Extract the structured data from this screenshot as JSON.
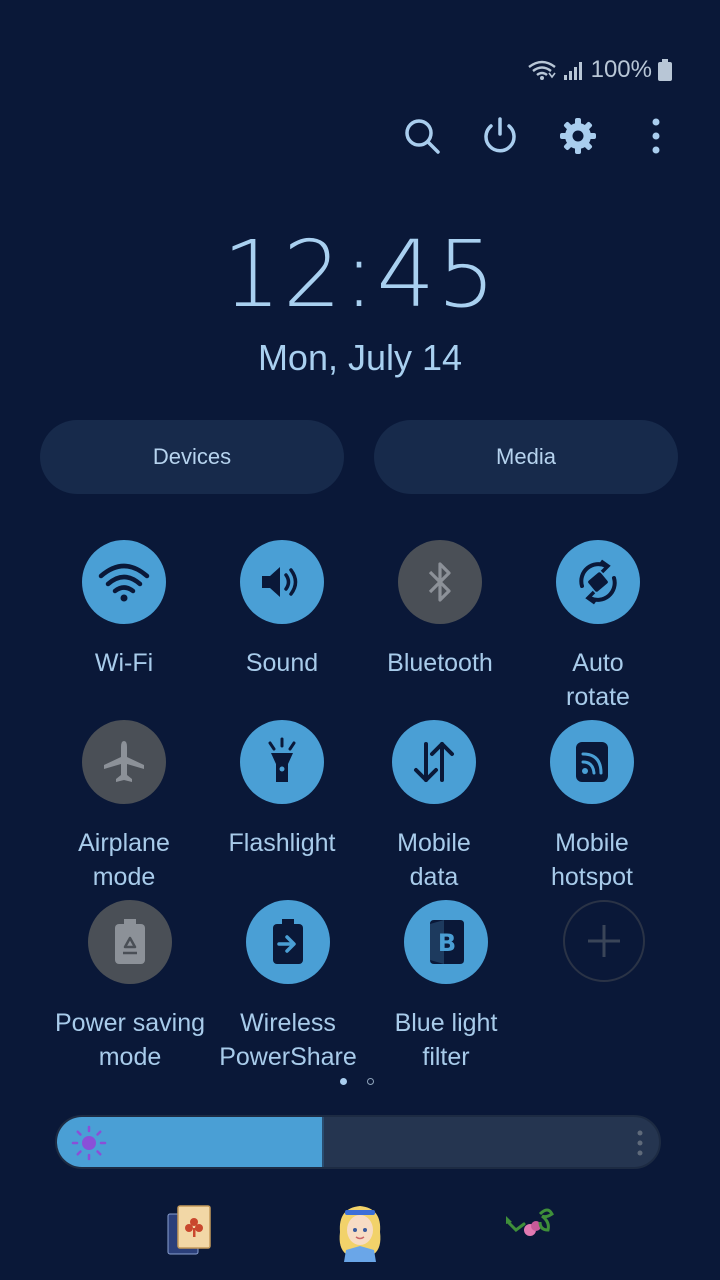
{
  "status": {
    "battery_text": "100%"
  },
  "top_actions": [
    {
      "name": "search-icon"
    },
    {
      "name": "power-icon"
    },
    {
      "name": "settings-gear-icon"
    },
    {
      "name": "more-options-icon"
    }
  ],
  "clock": {
    "time": "12:45",
    "date": "Mon, July 14"
  },
  "pills": {
    "devices": "Devices",
    "media": "Media"
  },
  "tiles": [
    {
      "label": "Wi-Fi",
      "state": "on"
    },
    {
      "label": "Sound",
      "state": "on"
    },
    {
      "label": "Bluetooth",
      "state": "off"
    },
    {
      "label": "Auto\nrotate",
      "state": "on"
    },
    {
      "label": "Airplane\nmode",
      "state": "off"
    },
    {
      "label": "Flashlight",
      "state": "on"
    },
    {
      "label": "Mobile\ndata",
      "state": "on"
    },
    {
      "label": "Mobile\nhotspot",
      "state": "on"
    },
    {
      "label": "Power saving\nmode",
      "state": "off"
    },
    {
      "label": "Wireless\nPowerShare",
      "state": "on"
    },
    {
      "label": "Blue light\nfilter",
      "state": "on"
    }
  ],
  "pagination": {
    "current": 1,
    "total": 2
  },
  "brightness": {
    "level": 0.44
  },
  "colors": {
    "accent": "#4a9fd5",
    "background": "#0a1838",
    "off": "#4a4f56"
  },
  "bottom_apps": [
    {
      "name": "solitaire-app-icon"
    },
    {
      "name": "alice-app-icon"
    },
    {
      "name": "flower-app-icon"
    }
  ]
}
